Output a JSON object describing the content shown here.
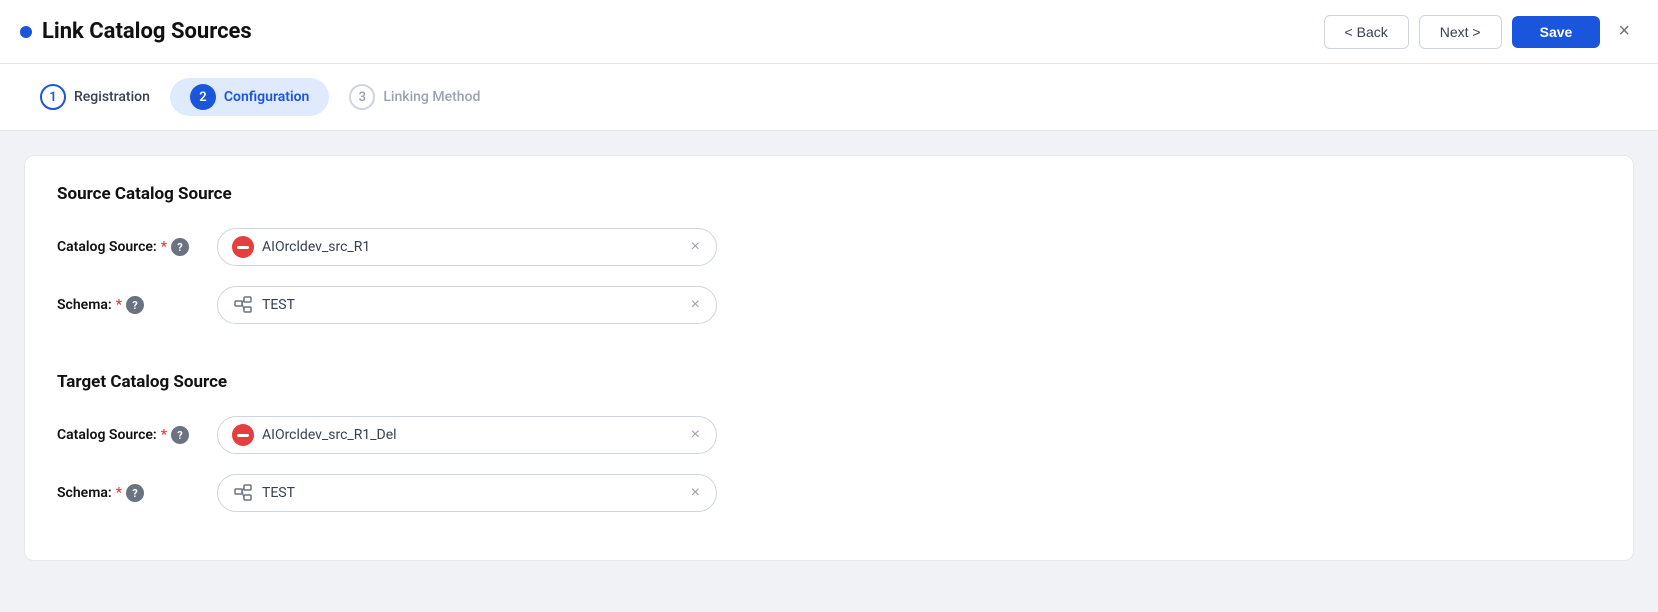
{
  "header": {
    "dot_color": "#1a56db",
    "title": "Link Catalog Sources",
    "back_label": "< Back",
    "next_label": "Next >",
    "save_label": "Save",
    "close_icon": "×"
  },
  "stepper": {
    "steps": [
      {
        "number": "1",
        "label": "Registration",
        "state": "inactive"
      },
      {
        "number": "2",
        "label": "Configuration",
        "state": "active"
      },
      {
        "number": "3",
        "label": "Linking Method",
        "state": "disabled"
      }
    ]
  },
  "source_section": {
    "title": "Source Catalog Source",
    "catalog_label": "Catalog Source:",
    "catalog_value": "AIOrcldev_src_R1",
    "schema_label": "Schema:",
    "schema_value": "TEST"
  },
  "target_section": {
    "title": "Target Catalog Source",
    "catalog_label": "Catalog Source:",
    "catalog_value": "AIOrcldev_src_R1_Del",
    "schema_label": "Schema:",
    "schema_value": "TEST"
  }
}
